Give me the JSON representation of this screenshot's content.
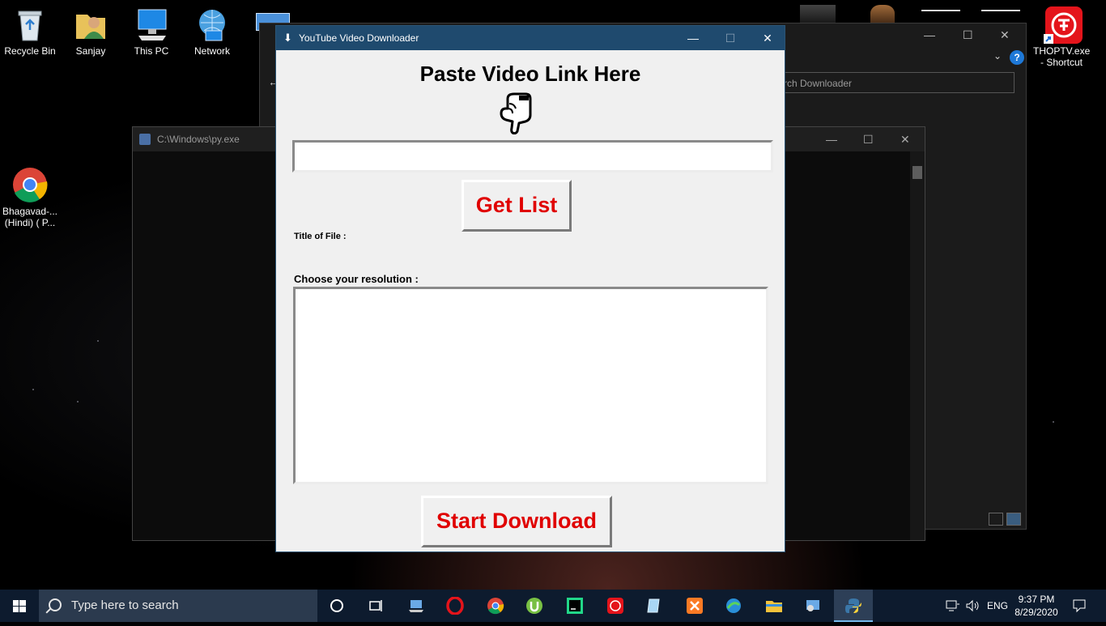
{
  "desktop": {
    "icons_left": [
      {
        "label": "Recycle Bin",
        "icon": "recycle-bin-icon"
      },
      {
        "label": "Sanjay",
        "icon": "user-folder-icon"
      },
      {
        "label": "This PC",
        "icon": "computer-icon"
      },
      {
        "label": "Network",
        "icon": "network-icon"
      }
    ],
    "chrome_shortcut": {
      "line1": "Bhagavad-...",
      "line2": "(Hindi) ( P..."
    },
    "thoptv_shortcut": {
      "line1": "THOPTV.exe",
      "line2": "- Shortcut"
    }
  },
  "explorer": {
    "search_placeholder": "rch Downloader",
    "help_glyph": "?"
  },
  "console": {
    "title": "C:\\Windows\\py.exe"
  },
  "app": {
    "title": "YouTube Video Downloader",
    "heading": "Paste Video Link Here",
    "link_input_value": "",
    "get_list_label": "Get List",
    "title_of_file_label": "Title of File :",
    "resolution_label": "Choose your resolution :",
    "start_download_label": "Start Download",
    "colors": {
      "button_text": "#e00000",
      "titlebar": "#1f4a6e"
    }
  },
  "window_controls": {
    "minimize": "—",
    "maximize": "☐",
    "close": "✕"
  },
  "taskbar": {
    "search_placeholder": "Type here to search",
    "pinned": [
      "cortana-icon",
      "task-view-icon",
      "laptop-app-icon",
      "opera-icon",
      "chrome-icon",
      "utorrent-icon",
      "pycharm-icon",
      "thoptv-icon",
      "notepad-icon",
      "xampp-icon",
      "network-globe-icon",
      "file-explorer-icon",
      "control-panel-icon",
      "python-icon"
    ],
    "language": "ENG",
    "time": "9:37 PM",
    "date": "8/29/2020"
  }
}
